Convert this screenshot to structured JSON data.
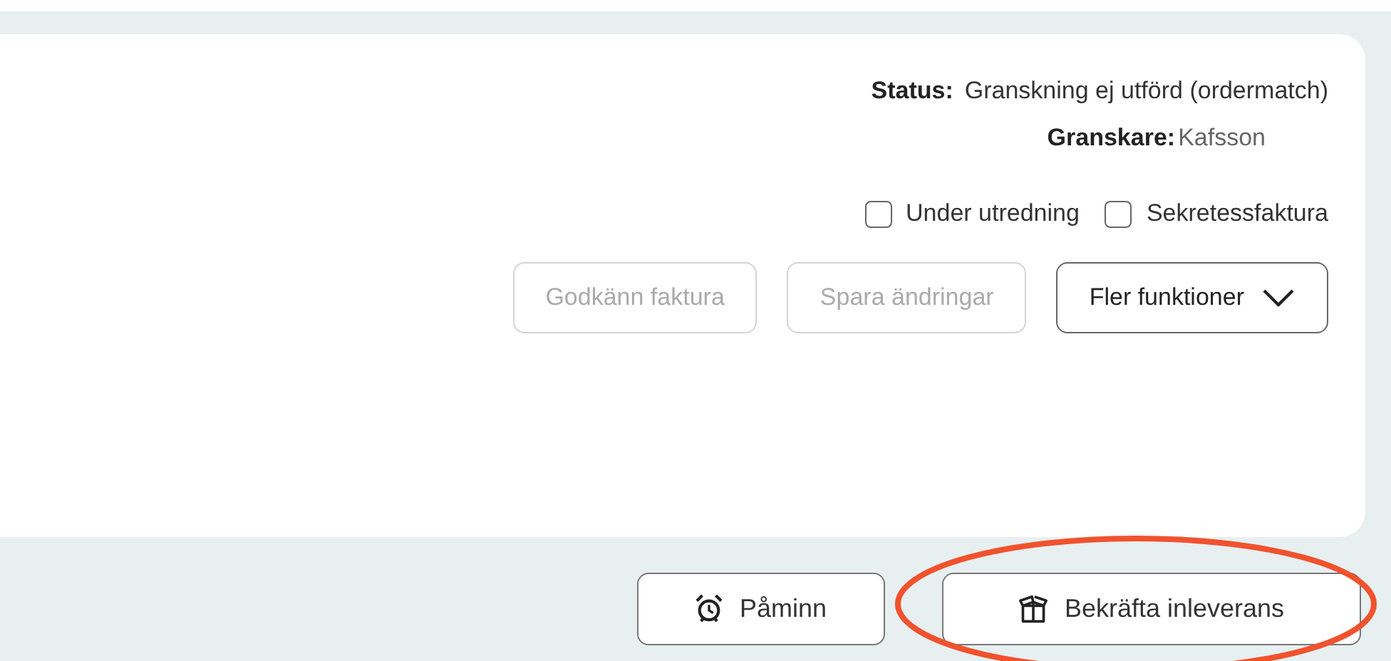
{
  "details": {
    "status_label": "Status:",
    "status_value": "Granskning ej utförd (ordermatch)",
    "reviewer_label": "Granskare:",
    "reviewer_value": "Kafsson"
  },
  "checkboxes": [
    {
      "label": "Under utredning",
      "checked": false
    },
    {
      "label": "Sekretessfaktura",
      "checked": false
    }
  ],
  "actions": [
    {
      "label": "Godkänn faktura",
      "kind": "plain",
      "disabled": true
    },
    {
      "label": "Spara ändringar",
      "kind": "plain",
      "disabled": true
    },
    {
      "label": "Fler funktioner",
      "kind": "dropdown",
      "disabled": false
    }
  ],
  "footer_buttons": [
    {
      "label": "Påminn",
      "kind": "reminder",
      "highlighted": false
    },
    {
      "label": "Bekräfta inleverans",
      "kind": "delivery",
      "highlighted": true
    }
  ]
}
